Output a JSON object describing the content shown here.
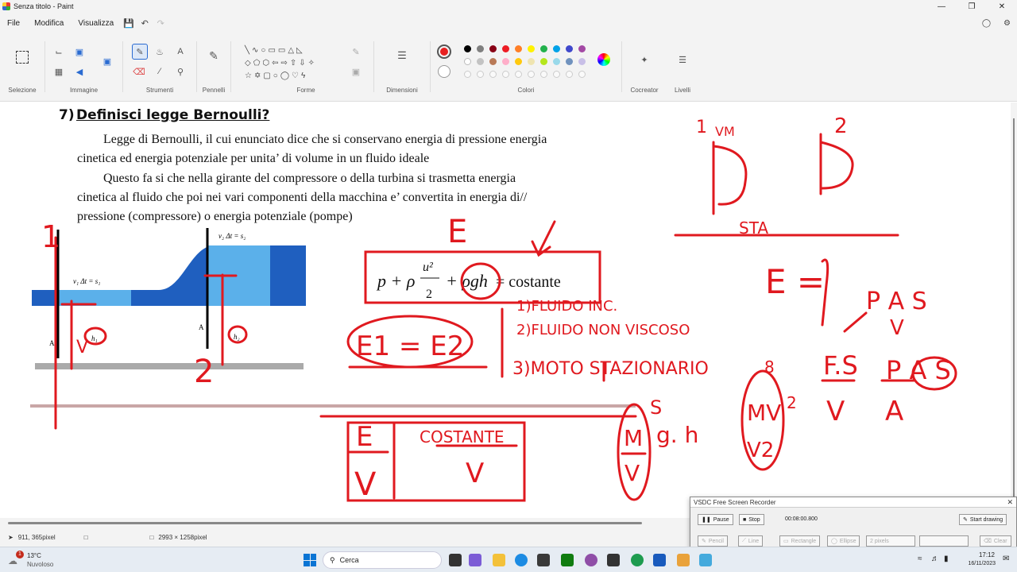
{
  "window": {
    "title": "Senza titolo - Paint"
  },
  "menu": {
    "file": "File",
    "edit": "Modifica",
    "view": "Visualizza"
  },
  "ribbon": {
    "selezione": "Selezione",
    "immagine": "Immagine",
    "strumenti": "Strumenti",
    "pennelli": "Pennelli",
    "forme": "Forme",
    "dimensioni": "Dimensioni",
    "colori": "Colori",
    "cocreator": "Cocreator",
    "livelli": "Livelli",
    "palette": [
      "#000000",
      "#7f7f7f",
      "#880015",
      "#ed1c24",
      "#ff7f27",
      "#fff200",
      "#22b14c",
      "#00a2e8",
      "#3f48cc",
      "#a349a4",
      "#ffffff",
      "#c3c3c3",
      "#b97a57",
      "#ffaec9",
      "#ffc90e",
      "#efe4b0",
      "#b5e61d",
      "#99d9ea",
      "#7092be",
      "#c8bfe7"
    ],
    "active_color": "#e82020"
  },
  "document": {
    "heading_num": "7)",
    "heading": "Definisci legge Bernoulli?",
    "p1a": "Legge di Bernoulli, il cui enunciato dice che si conservano energia di pressione energia",
    "p1b": "cinetica ed energia potenziale per unita’ di volume  in un fluido ideale",
    "p2a": "Questo fa si che nella girante del compressore o della turbina si trasmetta energia",
    "p2b": "cinetica al fluido che poi nei vari componenti della macchina e’ convertita in energia di//",
    "p2c": "pressione (compressore) o energia potenziale (pompe)",
    "eq_rest": "= costante",
    "fig_v2": "v₂ Δt = s₂",
    "fig_v1": "v₁ Δt = s₁",
    "fig_h1": "h₁",
    "fig_h2": "h₂",
    "fig_A1": "A",
    "fig_A2": "A"
  },
  "annotations": {
    "one": "1",
    "two": "2",
    "E": "E",
    "e1e2": "E1 = E2",
    "c1": "1)FLUIDO INC.",
    "c2": "2)FLUIDO NON VISCOSO",
    "c3": "3)MOTO STAZIONARIO",
    "costante": "COSTANTE",
    "E_box": "E",
    "V_box": "V",
    "sta": "STA",
    "Eeq": "E =",
    "PAS": "P A S",
    "FS": "F.S",
    "PAS2": "P A S",
    "MgH": "M",
    "gh": "g. h",
    "MV": "MV",
    "V2": "V2",
    "vm": "VM",
    "top1": "1",
    "top2": "2",
    "V1": "V",
    "A1": "A",
    "A2": "A",
    "V3": "V",
    "V4": "V",
    "sq": "2",
    "s": "S",
    "dot": "8"
  },
  "statusbar": {
    "coords": "911, 365pixel",
    "size": "2993 × 1258pixel"
  },
  "vsdc": {
    "title": "VSDC Free Screen Recorder",
    "pause": "Pause",
    "stop": "Stop",
    "time": "00:08:00.800",
    "start": "Start drawing",
    "pixels": "2 pixels",
    "b1": "Pencil",
    "b2": "Line",
    "b3": "Rectangle",
    "b4": "Ellipse",
    "b5": "Clear"
  },
  "taskbar": {
    "temp": "13°C",
    "weather": "Nuvoloso",
    "search": "Cerca",
    "time": "17:12",
    "date": "16/11/2023",
    "badge": "1"
  }
}
